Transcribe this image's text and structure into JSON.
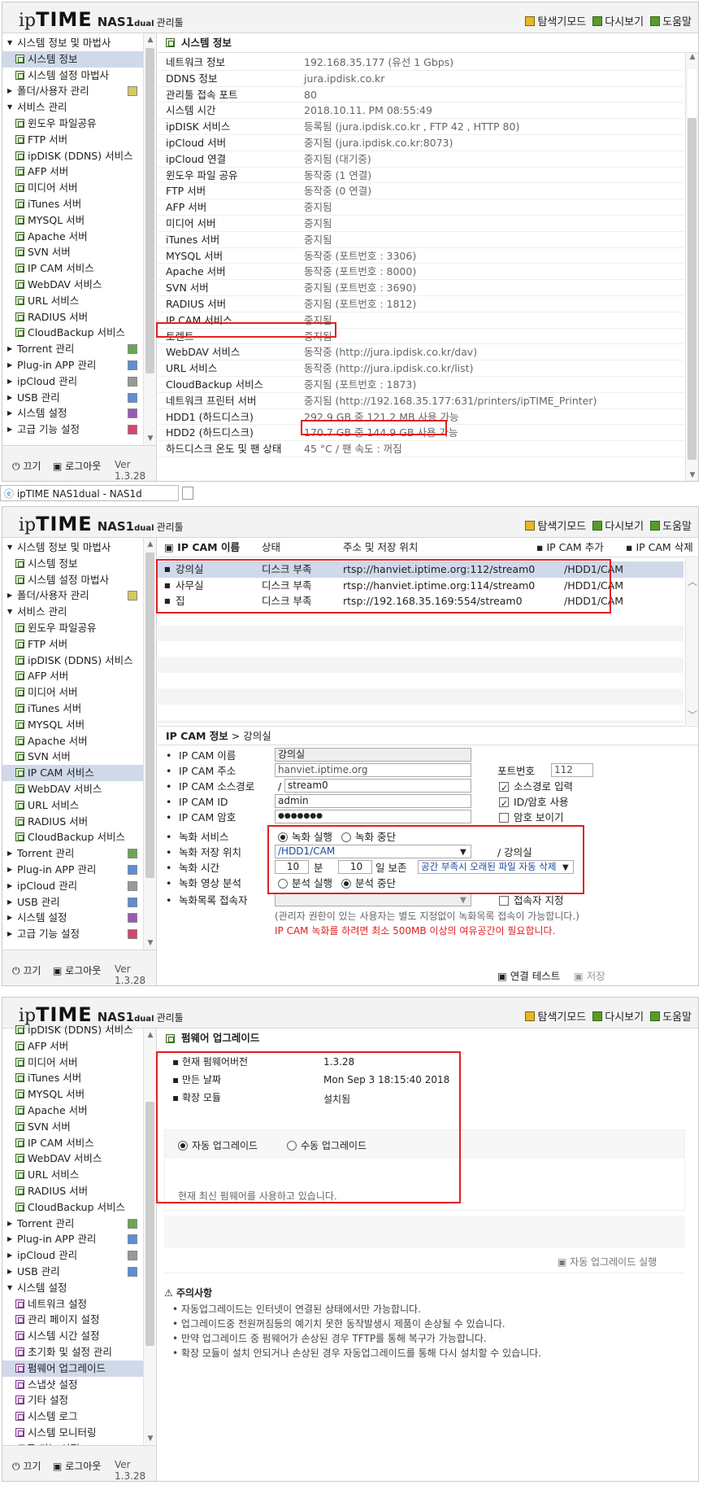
{
  "header": {
    "logo_ip": "ip",
    "logo_time": "TIME",
    "logo_model": "NAS1",
    "logo_dual": "dual",
    "logo_mgr": "관리툴",
    "links": [
      "탐색기모드",
      "다시보기",
      "도움말"
    ]
  },
  "sidebar_footer": {
    "off": "끄기",
    "logout": "로그아웃",
    "version": "Ver 1.3.28"
  },
  "panel1": {
    "tree": [
      "시스템 정보 및 마법사",
      "시스템 정보",
      "시스템 설정 마법사",
      "폴더/사용자 관리",
      "서비스 관리",
      "윈도우 파일공유",
      "FTP 서버",
      "ipDISK (DDNS) 서비스",
      "AFP 서버",
      "미디어 서버",
      "iTunes 서버",
      "MYSQL 서버",
      "Apache 서버",
      "SVN 서버",
      "IP CAM 서비스",
      "WebDAV 서비스",
      "URL 서비스",
      "RADIUS 서버",
      "CloudBackup 서비스",
      "Torrent 관리",
      "Plug-in APP 관리",
      "ipCloud 관리",
      "USB 관리",
      "시스템 설정",
      "고급 기능 설정"
    ],
    "title": "시스템 정보",
    "rows": [
      {
        "k": "네트워크 정보",
        "v": "192.168.35.177 (유선 1 Gbps)"
      },
      {
        "k": "DDNS 정보",
        "v": "jura.ipdisk.co.kr"
      },
      {
        "k": "관리툴 접속 포트",
        "v": "80"
      },
      {
        "k": "시스템 시간",
        "v": "2018.10.11. PM 08:55:49"
      },
      {
        "k": "ipDISK 서비스",
        "v": "등록됨 (jura.ipdisk.co.kr , FTP 42 , HTTP 80)"
      },
      {
        "k": "ipCloud 서버",
        "v": "중지됨 (jura.ipdisk.co.kr:8073)"
      },
      {
        "k": "ipCloud 연결",
        "v": "중지됨 (대기중)"
      },
      {
        "k": "윈도우 파일 공유",
        "v": "동작중 (1 연결)"
      },
      {
        "k": "FTP 서버",
        "v": "동작중 (0 연결)"
      },
      {
        "k": "AFP 서버",
        "v": "중지됨"
      },
      {
        "k": "미디어 서버",
        "v": "중지됨"
      },
      {
        "k": "iTunes 서버",
        "v": "중지됨"
      },
      {
        "k": "MYSQL 서버",
        "v": "동작중 (포트번호 : 3306)"
      },
      {
        "k": "Apache 서버",
        "v": "동작중 (포트번호 : 8000)"
      },
      {
        "k": "SVN 서버",
        "v": "중지됨 (포트번호 : 3690)"
      },
      {
        "k": "RADIUS 서버",
        "v": "중지됨 (포트번호 : 1812)"
      },
      {
        "k": "IP CAM 서비스",
        "v": "중지됨"
      },
      {
        "k": "토렌트",
        "v": "중지됨"
      },
      {
        "k": "WebDAV 서비스",
        "v": "동작중 (http://jura.ipdisk.co.kr/dav)"
      },
      {
        "k": "URL 서비스",
        "v": "동작중 (http://jura.ipdisk.co.kr/list)"
      },
      {
        "k": "CloudBackup 서비스",
        "v": "중지됨 (포트번호 : 1873)"
      },
      {
        "k": "네트워크 프린터 서버",
        "v": "중지됨 (http://192.168.35.177:631/printers/ipTIME_Printer)"
      },
      {
        "k": "HDD1 (하드디스크)",
        "v": "292.9 GB 중 121.2 MB 사용 가능"
      },
      {
        "k": "HDD2 (하드디스크)",
        "v": "170.7 GB 중 144.9 GB 사용 가능"
      },
      {
        "k": "하드디스크 온도 및 팬 상태",
        "v": "45 °C / 팬 속도 : 꺼짐"
      }
    ]
  },
  "taskbar": {
    "title": "ipTIME NAS1dual - NAS1d"
  },
  "panel2": {
    "list_header": {
      "name": "IP CAM 이름",
      "status": "상태",
      "addr": "주소 및 저장 위치",
      "add": "IP CAM 추가",
      "del": "IP CAM 삭제"
    },
    "cams": [
      {
        "name": "강의실",
        "status": "디스크 부족",
        "addr": "rtsp://hanviet.iptime.org:112/stream0",
        "path": "/HDD1/CAM"
      },
      {
        "name": "사무실",
        "status": "디스크 부족",
        "addr": "rtsp://hanviet.iptime.org:114/stream0",
        "path": "/HDD1/CAM"
      },
      {
        "name": "집",
        "status": "디스크 부족",
        "addr": "rtsp://192.168.35.169:554/stream0",
        "path": "/HDD1/CAM"
      }
    ],
    "info_title": "IP CAM 정보",
    "info_sep": " > ",
    "info_cam": "강의실",
    "labels": {
      "name": "IP CAM 이름",
      "addr": "IP CAM 주소",
      "src": "IP CAM 소스경로",
      "id": "IP CAM ID",
      "pw": "IP CAM 암호",
      "rec": "녹화 서비스",
      "loc": "녹화 저장 위치",
      "time": "녹화 시간",
      "analysis": "녹화 영상 분석",
      "access": "녹화목록 접속자"
    },
    "values": {
      "name": "강의실",
      "addr": "hanviet.iptime.org",
      "src_prefix": "/",
      "src": "stream0",
      "id": "admin",
      "pw": "●●●●●●●",
      "port_label": "포트번호",
      "port": "112",
      "src_chk": "소스경로 입력",
      "id_chk": "ID/암호 사용",
      "pw_chk": "암호 보이기",
      "rec_on": "녹화 실행",
      "rec_off": "녹화 중단",
      "loc": "/HDD1/CAM",
      "loc_suffix": "/ 강의실",
      "min": "10",
      "min_unit": "분",
      "day": "10",
      "day_unit": "일 보존",
      "delete_opt": "공간 부족시 오래된 파일 자동 삭제",
      "an_on": "분석 실행",
      "an_off": "분석 중단",
      "access_chk": "접속자 지정",
      "note1": "(관리자 권한이 있는 사용자는 별도 지정없이 녹화목록 접속이 가능합니다.)",
      "note2": "IP CAM 녹화를 하려면 최소 500MB 이상의 여유공간이 필요합니다.",
      "test": "연결 테스트",
      "save": "저장"
    },
    "tree": [
      "시스템 정보 및 마법사",
      "시스템 정보",
      "시스템 설정 마법사",
      "폴더/사용자 관리",
      "서비스 관리",
      "윈도우 파일공유",
      "FTP 서버",
      "ipDISK (DDNS) 서비스",
      "AFP 서버",
      "미디어 서버",
      "iTunes 서버",
      "MYSQL 서버",
      "Apache 서버",
      "SVN 서버",
      "IP CAM 서비스",
      "WebDAV 서비스",
      "URL 서비스",
      "RADIUS 서버",
      "CloudBackup 서비스",
      "Torrent 관리",
      "Plug-in APP 관리",
      "ipCloud 관리",
      "USB 관리",
      "시스템 설정",
      "고급 기능 설정"
    ]
  },
  "panel3": {
    "tree": [
      "ipDISK (DDNS) 서비스",
      "AFP 서버",
      "미디어 서버",
      "iTunes 서버",
      "MYSQL 서버",
      "Apache 서버",
      "SVN 서버",
      "IP CAM 서비스",
      "WebDAV 서비스",
      "URL 서비스",
      "RADIUS 서버",
      "CloudBackup 서비스",
      "Torrent 관리",
      "Plug-in APP 관리",
      "ipCloud 관리",
      "USB 관리",
      "시스템 설정",
      "네트워크 설정",
      "관리 페이지 설정",
      "시스템 시간 설정",
      "초기화 및 설정 관리",
      "펌웨어 업그레이드",
      "스냅샷 설정",
      "기타 설정",
      "시스템 로그",
      "시스템 모니터링",
      "고급 기능 설정"
    ],
    "title": "펌웨어 업그레이드",
    "fw": [
      {
        "k": "현재 펌웨어버전",
        "v": "1.3.28"
      },
      {
        "k": "만든 날짜",
        "v": "Mon Sep 3 18:15:40 2018"
      },
      {
        "k": "확장 모듈",
        "v": "설치됨"
      }
    ],
    "auto": "자동 업그레이드",
    "manual": "수동 업그레이드",
    "status": "현재 최신 펌웨어를 사용하고 있습니다.",
    "run": "자동 업그레이드 실행",
    "caution_title": "주의사항",
    "caution": [
      "자동업그레이드는 인터넷이 연결된 상태에서만 가능합니다.",
      "업그레이드중 전원꺼짐등의 예기치 못한 동작발생시 제품이 손상될 수 있습니다.",
      "만약 업그레이드 중 펌웨어가 손상된 경우 TFTP를 통해 복구가 가능합니다.",
      "확장 모듈이 설치 안되거나 손상된 경우 자동업그레이드를 통해 다시 설치할 수 있습니다."
    ]
  }
}
